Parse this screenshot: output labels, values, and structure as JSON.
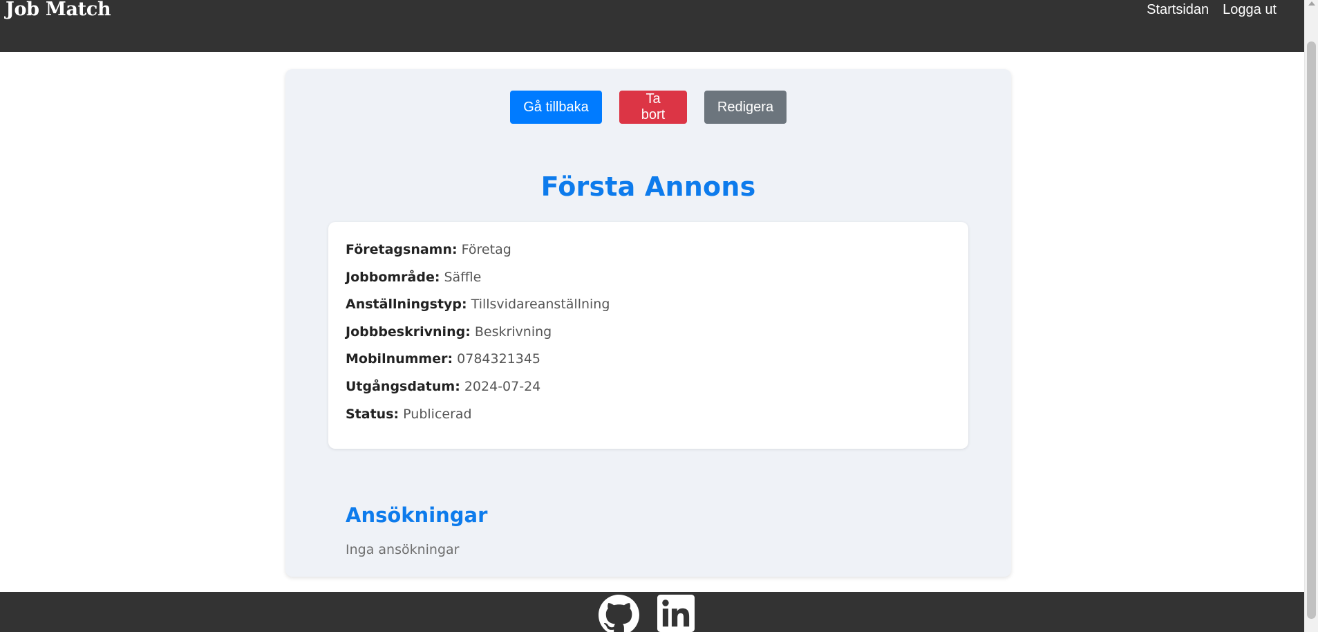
{
  "header": {
    "brand": "Job Match",
    "nav": [
      {
        "label": "Startsidan"
      },
      {
        "label": "Logga ut"
      }
    ]
  },
  "actions": {
    "back": "Gå tillbaka",
    "delete": "Ta bort",
    "edit": "Redigera"
  },
  "ad": {
    "title": "Första Annons",
    "fields": [
      {
        "label": "Företagsnamn:",
        "value": "Företag"
      },
      {
        "label": "Jobbområde:",
        "value": "Säffle"
      },
      {
        "label": "Anställningstyp:",
        "value": "Tillsvidareanställning"
      },
      {
        "label": "Jobbbeskrivning:",
        "value": "Beskrivning"
      },
      {
        "label": "Mobilnummer:",
        "value": "0784321345"
      },
      {
        "label": "Utgångsdatum:",
        "value": "2024-07-24"
      },
      {
        "label": "Status:",
        "value": "Publicerad"
      }
    ]
  },
  "applications": {
    "title": "Ansökningar",
    "empty_text": "Inga ansökningar"
  },
  "colors": {
    "accent": "#0d7bec",
    "primary": "#007bff",
    "danger": "#dc3545",
    "secondary": "#6c757d",
    "bar": "#333333",
    "panel": "#eff2f7"
  },
  "footer": {
    "icons": [
      "github-icon",
      "linkedin-icon"
    ]
  }
}
